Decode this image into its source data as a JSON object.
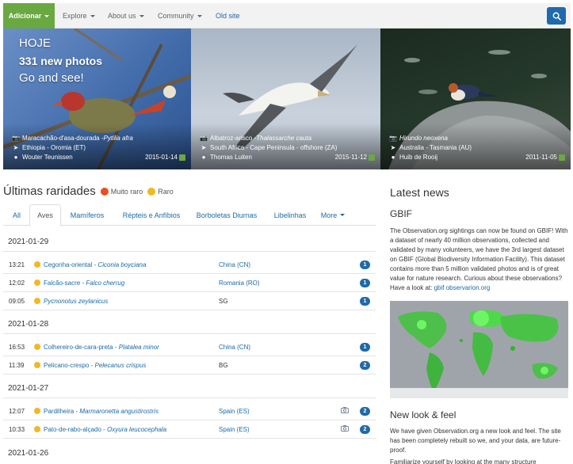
{
  "navbar": {
    "add_label": "Adicionar",
    "items": [
      {
        "label": "Explore"
      },
      {
        "label": "About us"
      },
      {
        "label": "Community"
      },
      {
        "label": "Old site"
      }
    ]
  },
  "hero": {
    "line1": "HOJE",
    "line2": "331 new photos",
    "line3": "Go and see!",
    "panels": [
      {
        "species_common": "Maracachão-d'asa-dourada - ",
        "species_sci": "Pytilia afra",
        "location": "Ethiopia - Oromia (ET)",
        "user": "Wouter Teunissen",
        "date": "2015-01-14"
      },
      {
        "species_common": "Albatroz-arisco - ",
        "species_sci": "Thalassarche cauta",
        "location": "South Africa - Cape Peninsula - offshore (ZA)",
        "user": "Thomas Luiten",
        "date": "2015-11-12"
      },
      {
        "species_common": "",
        "species_sci": "Hirundo neoxena",
        "location": "Australia - Tasmania (AU)",
        "user": "Huib de Rooij",
        "date": "2011-11-05"
      }
    ]
  },
  "rarities": {
    "title": "Últimas raridades",
    "legend_very_rare": "Muito raro",
    "legend_rare": "Raro",
    "colors": {
      "very_rare": "#e8501f",
      "rare": "#f2b824",
      "accent": "#1e6aab",
      "green": "#6aa842"
    },
    "tabs": [
      {
        "label": "All"
      },
      {
        "label": "Aves"
      },
      {
        "label": "Mamíferos"
      },
      {
        "label": "Répteis e Anfíbios"
      },
      {
        "label": "Borboletas Diurnas"
      },
      {
        "label": "Libelinhas"
      },
      {
        "label": "More"
      }
    ],
    "dates": [
      "2021-01-29",
      "2021-01-28",
      "2021-01-27",
      "2021-01-26"
    ],
    "rows": [
      {
        "time": "13:21",
        "common": "Cegonha-oriental - ",
        "sci": "Ciconia boyciana",
        "location": "China (CN)",
        "count": "1",
        "photo": false
      },
      {
        "time": "12:02",
        "common": "Falcão-sacre - ",
        "sci": "Falco cherrug",
        "location": "Romania (RO)",
        "count": "1",
        "photo": false
      },
      {
        "time": "09:05",
        "common": "",
        "sci": "Pycnonotus zeylanicus",
        "location": "SG",
        "count": "1",
        "photo": false
      },
      {
        "time": "16:53",
        "common": "Colhereiro-de-cara-preta - ",
        "sci": "Platalea minor",
        "location": "China (CN)",
        "count": "1",
        "photo": false
      },
      {
        "time": "11:39",
        "common": "Pelicano-crespo - ",
        "sci": "Pelecanus crispus",
        "location": "BG",
        "count": "2",
        "photo": false
      },
      {
        "time": "12:07",
        "common": "Pardilheira - ",
        "sci": "Marmaronetta angustirostris",
        "location": "Spain (ES)",
        "count": "2",
        "photo": true
      },
      {
        "time": "10:33",
        "common": "Pato-de-rabo-alçado - ",
        "sci": "Oxyura leucocephala",
        "location": "Spain (ES)",
        "count": "2",
        "photo": true
      }
    ]
  },
  "news": {
    "title": "Latest news",
    "gbif_title": "GBIF",
    "gbif_text": "The Observation.org sightings can now be found on GBIF! With a dataset of nearly 40 million observations, collected and validated by many volunteers, we have the 3rd largest dataset on GBIF (Global Biodiversity Information Facility). This dataset contains more than 5 million validated photos and is of great value for nature research. Curious about these observations? Have a look at: ",
    "gbif_link": "gbif observarion.org",
    "look_title": "New look & feel",
    "look_text": "We have given Observation.org a new look and feel. The site has been completely rebuilt so we, and your data, are future-proof.",
    "look_text2": "Familiarize yourself by looking at the many structure"
  }
}
